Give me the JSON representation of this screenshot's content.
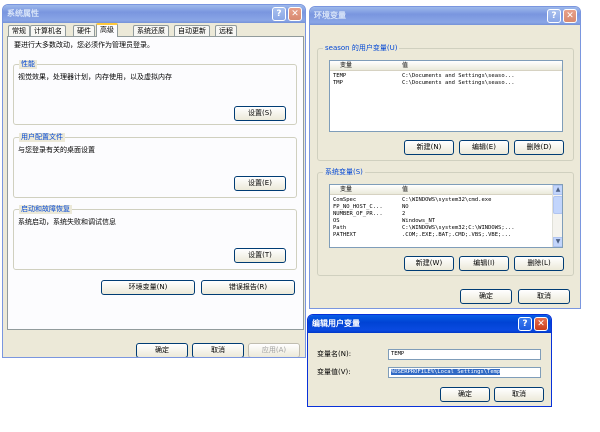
{
  "sysprops": {
    "title": "系统属性",
    "tabs": [
      "常规",
      "计算机名",
      "硬件",
      "高级",
      "系统还原",
      "自动更新",
      "远程"
    ],
    "active_tab": "高级",
    "admin_note": "要进行大多数改动，您必须作为管理员登录。",
    "performance": {
      "title": "性能",
      "desc": "视觉效果，处理器计划，内存使用，以及虚拟内存",
      "button": "设置(S)"
    },
    "user_profiles": {
      "title": "用户配置文件",
      "desc": "与您登录有关的桌面设置",
      "button": "设置(E)"
    },
    "startup_recovery": {
      "title": "启动和故障恢复",
      "desc": "系统启动，系统失败和调试信息",
      "button": "设置(T)"
    },
    "env_button": "环境变量(N)",
    "error_report_button": "错误报告(R)",
    "ok": "确定",
    "cancel": "取消",
    "apply": "应用(A)"
  },
  "envvars": {
    "title": "环境变量",
    "user_group": "season 的用户变量(U)",
    "col_var": "变量",
    "col_val": "值",
    "user_vars": [
      {
        "name": "TEMP",
        "value": "C:\\Documents and Settings\\seaso..."
      },
      {
        "name": "TMP",
        "value": "C:\\Documents and Settings\\seaso..."
      }
    ],
    "user_buttons": {
      "new": "新建(N)",
      "edit": "编辑(E)",
      "delete": "删除(D)"
    },
    "sys_group": "系统变量(S)",
    "sys_vars": [
      {
        "name": "ComSpec",
        "value": "C:\\WINDOWS\\system32\\cmd.exe"
      },
      {
        "name": "FP_NO_HOST_C...",
        "value": "NO"
      },
      {
        "name": "NUMBER_OF_PR...",
        "value": "2"
      },
      {
        "name": "OS",
        "value": "Windows_NT"
      },
      {
        "name": "Path",
        "value": "C:\\WINDOWS\\system32;C:\\WINDOWS;..."
      },
      {
        "name": "PATHEXT",
        "value": ".COM;.EXE;.BAT;.CMD;.VBS;.VBE;..."
      }
    ],
    "sys_buttons": {
      "new": "新建(W)",
      "edit": "编辑(I)",
      "delete": "删除(L)"
    },
    "ok": "确定",
    "cancel": "取消"
  },
  "edit_user_var": {
    "title": "编辑用户变量",
    "name_label": "变量名(N):",
    "name_value": "TEMP",
    "value_label": "变量值(V):",
    "value_value": "%USERPROFILE%\\Local Settings\\Temp",
    "ok": "确定",
    "cancel": "取消"
  },
  "titlebar_buttons": {
    "help": "?",
    "close": "✕"
  },
  "icons": {
    "scroll_up": "▲",
    "scroll_down": "▼"
  }
}
